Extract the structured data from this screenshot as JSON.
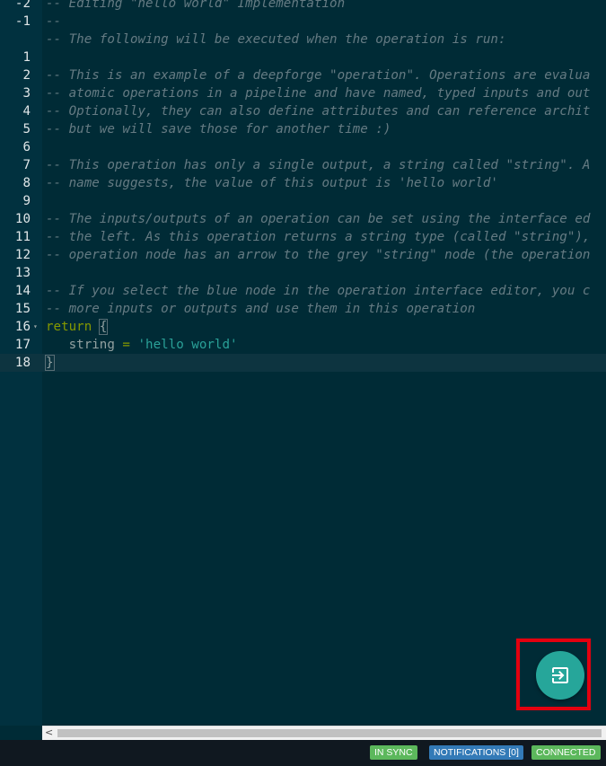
{
  "editor": {
    "lines": [
      {
        "num": "-2",
        "fold": false,
        "tokens": [
          {
            "t": "comment",
            "v": "-- Editing \"hello world\" Implementation"
          }
        ]
      },
      {
        "num": "-1",
        "fold": false,
        "tokens": [
          {
            "t": "comment",
            "v": "--"
          }
        ]
      },
      {
        "num": "",
        "fold": false,
        "tokens": [
          {
            "t": "comment",
            "v": "-- The following will be executed when the operation is run:"
          }
        ]
      },
      {
        "num": "1",
        "fold": false,
        "tokens": []
      },
      {
        "num": "2",
        "fold": false,
        "tokens": [
          {
            "t": "comment",
            "v": "-- This is an example of a deepforge \"operation\". Operations are evalua"
          }
        ]
      },
      {
        "num": "3",
        "fold": false,
        "tokens": [
          {
            "t": "comment",
            "v": "-- atomic operations in a pipeline and have named, typed inputs and out"
          }
        ]
      },
      {
        "num": "4",
        "fold": false,
        "tokens": [
          {
            "t": "comment",
            "v": "-- Optionally, they can also define attributes and can reference archit"
          }
        ]
      },
      {
        "num": "5",
        "fold": false,
        "tokens": [
          {
            "t": "comment",
            "v": "-- but we will save those for another time :)"
          }
        ]
      },
      {
        "num": "6",
        "fold": false,
        "tokens": []
      },
      {
        "num": "7",
        "fold": false,
        "tokens": [
          {
            "t": "comment",
            "v": "-- This operation has only a single output, a string called \"string\". A"
          }
        ]
      },
      {
        "num": "8",
        "fold": false,
        "tokens": [
          {
            "t": "comment",
            "v": "-- name suggests, the value of this output is 'hello world'"
          }
        ]
      },
      {
        "num": "9",
        "fold": false,
        "tokens": []
      },
      {
        "num": "10",
        "fold": false,
        "tokens": [
          {
            "t": "comment",
            "v": "-- The inputs/outputs of an operation can be set using the interface ed"
          }
        ]
      },
      {
        "num": "11",
        "fold": false,
        "tokens": [
          {
            "t": "comment",
            "v": "-- the left. As this operation returns a string type (called \"string\"),"
          }
        ]
      },
      {
        "num": "12",
        "fold": false,
        "tokens": [
          {
            "t": "comment",
            "v": "-- operation node has an arrow to the grey \"string\" node (the operation"
          }
        ]
      },
      {
        "num": "13",
        "fold": false,
        "tokens": []
      },
      {
        "num": "14",
        "fold": false,
        "tokens": [
          {
            "t": "comment",
            "v": "-- If you select the blue node in the operation interface editor, you c"
          }
        ]
      },
      {
        "num": "15",
        "fold": false,
        "tokens": [
          {
            "t": "comment",
            "v": "-- more inputs or outputs and use them in this operation"
          }
        ]
      },
      {
        "num": "16",
        "fold": true,
        "tokens": [
          {
            "t": "kw",
            "v": "return"
          },
          {
            "t": "ident",
            "v": " "
          },
          {
            "t": "brace-match",
            "v": "{"
          }
        ]
      },
      {
        "num": "17",
        "fold": false,
        "tokens": [
          {
            "t": "ident",
            "v": "   string "
          },
          {
            "t": "op",
            "v": "="
          },
          {
            "t": "ident",
            "v": " "
          },
          {
            "t": "str",
            "v": "'hello world'"
          }
        ]
      },
      {
        "num": "18",
        "fold": false,
        "active": true,
        "tokens": [
          {
            "t": "brace-match",
            "v": "}"
          }
        ]
      }
    ]
  },
  "icons": {
    "fold": "fold-arrow-icon",
    "fab": "exit-to-app-icon",
    "scroll_left": "scroll-left-arrow-icon"
  },
  "scrollbar": {
    "left_arrow": "<"
  },
  "fab": {
    "bg": "#26a69a",
    "highlight_border": "#e3000f"
  },
  "status": {
    "in_sync": "IN SYNC",
    "notifications": "NOTIFICATIONS [0]",
    "connected": "CONNECTED",
    "colors": {
      "in_sync": "#5cb85c",
      "notifications": "#337ab7",
      "connected": "#5cb85c"
    }
  }
}
